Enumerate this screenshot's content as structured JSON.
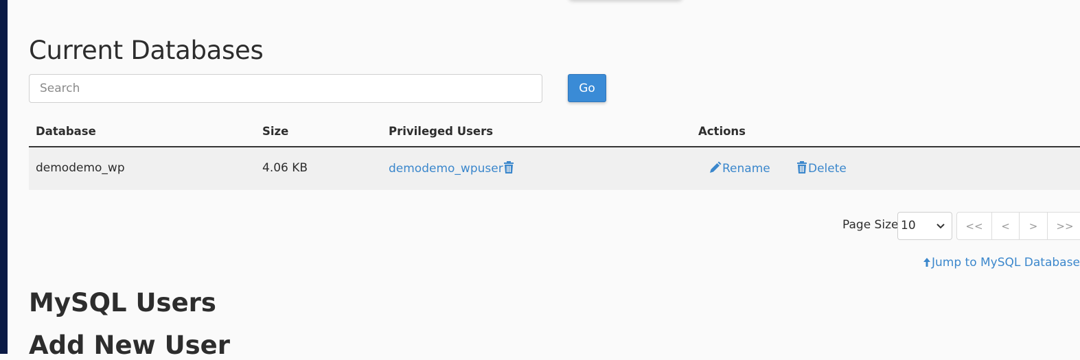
{
  "current_databases": {
    "title": "Current Databases",
    "search": {
      "placeholder": "Search",
      "value": ""
    },
    "go_label": "Go",
    "table": {
      "columns": [
        "Database",
        "Size",
        "Privileged Users",
        "Actions"
      ],
      "rows": [
        {
          "database": "demodemo_wp",
          "size": "4.06 KB",
          "privileged_user": "demodemo_wpuser",
          "actions": {
            "rename": "Rename",
            "delete": "Delete"
          }
        }
      ]
    },
    "pagination": {
      "page_size_label": "Page Size",
      "page_size_value": "10",
      "buttons": [
        "<<",
        "<",
        ">",
        ">>"
      ]
    },
    "jump_link": "Jump to MySQL Database"
  },
  "mysql_users": {
    "title": "MySQL Users",
    "add_new_user_title": "Add New User"
  },
  "colors": {
    "sidebar": "#0a1a45",
    "link": "#3b87cc",
    "primary_button": "#3a8bd6"
  }
}
